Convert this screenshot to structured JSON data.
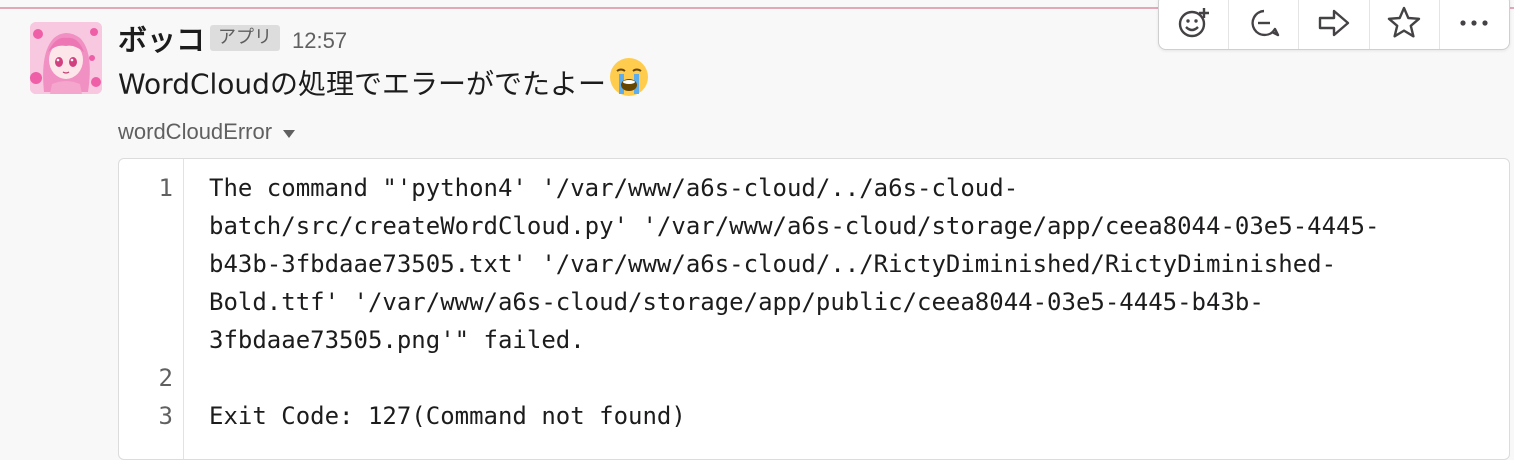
{
  "message": {
    "sender": "ボッコ",
    "badge": "アプリ",
    "time": "12:57",
    "text": "WordCloudの処理でエラーがでたよー",
    "emoji": "loudly-crying-face"
  },
  "toolbar": {
    "actions": [
      "add-reaction-icon",
      "reply-in-thread-icon",
      "share-icon",
      "star-icon",
      "more-actions-icon"
    ]
  },
  "snippet": {
    "title": "wordCloudError",
    "line_numbers": [
      "1",
      "2",
      "3"
    ],
    "lines": [
      "The command \"'python4' '/var/www/a6s-cloud/../a6s-cloud-",
      "batch/src/createWordCloud.py' '/var/www/a6s-cloud/storage/app/ceea8044-03e5-4445-",
      "b43b-3fbdaae73505.txt' '/var/www/a6s-cloud/../RictyDiminished/RictyDiminished-",
      "Bold.ttf' '/var/www/a6s-cloud/storage/app/public/ceea8044-03e5-4445-b43b-",
      "3fbdaae73505.png'\" failed.",
      "",
      "Exit Code: 127(Command not found)"
    ]
  }
}
